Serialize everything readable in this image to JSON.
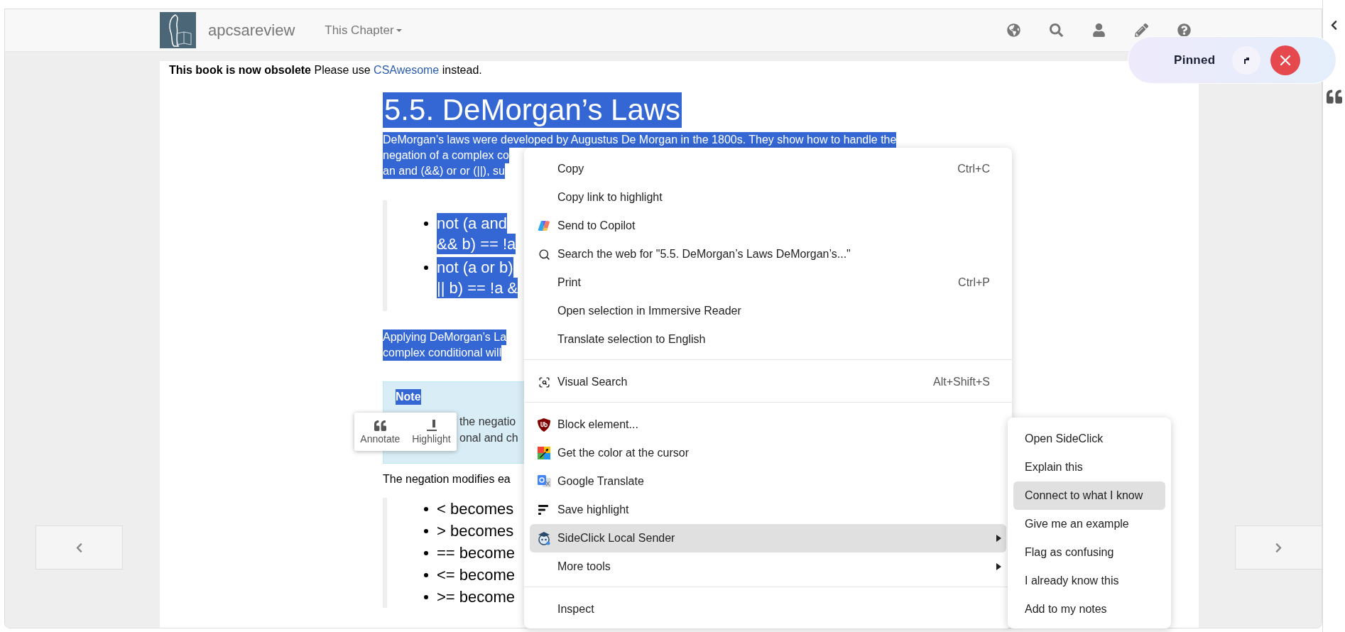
{
  "navbar": {
    "brand": "apcsareview",
    "menu": "This Chapter"
  },
  "notice": {
    "lead": "**This book is now obsolete** Please use",
    "link": "CSAwesome",
    "tail": "instead."
  },
  "article": {
    "heading": {
      "text": "5.5. DeMorgan’s Laws",
      "selected": true
    },
    "intro": {
      "selected": true,
      "lines": [
        "DeMorgan’s laws were developed by Augustus De Morgan in the 1800s. They show how to handle the",
        "negation of a complex co",
        "an and (&&) or or (||), su"
      ]
    },
    "laws": [
      {
        "selected": true,
        "lines": [
          "not (a and",
          "&& b) == !a"
        ]
      },
      {
        "selected": true,
        "lines": [
          "not (a or b)",
          "|| b) == !a &"
        ]
      }
    ],
    "applying": {
      "selected": true,
      "lines": [
        "Applying DeMorgan’s La",
        "complex conditional will"
      ]
    },
    "note": {
      "title": "Note",
      "title_selected": true,
      "lines": [
        "the negatio",
        "onal and ch"
      ]
    },
    "negation": {
      "text": "The negation modifies ea",
      "selected": false
    },
    "rules": [
      "< becomes",
      "> becomes",
      "== become",
      "<= become",
      ">= become"
    ]
  },
  "annotate_popup": {
    "buttons": [
      "Annotate",
      "Highlight"
    ]
  },
  "context_menu": {
    "groups": [
      [
        {
          "label": "Copy",
          "shortcut": "Ctrl+C",
          "submenu": false,
          "highlighted": false
        },
        {
          "label": "Copy link to highlight",
          "submenu": false,
          "highlighted": false
        },
        {
          "label": "Send to Copilot",
          "submenu": false,
          "highlighted": false
        },
        {
          "label": "Search the web for \"5.5. DeMorgan’s Laws DeMorgan’s...\"",
          "submenu": false,
          "highlighted": false
        },
        {
          "label": "Print",
          "shortcut": "Ctrl+P",
          "submenu": false,
          "highlighted": false
        },
        {
          "label": "Open selection in Immersive Reader",
          "submenu": false,
          "highlighted": false
        },
        {
          "label": "Translate selection to English",
          "submenu": false,
          "highlighted": false
        }
      ],
      [
        {
          "label": "Visual Search",
          "shortcut": "Alt+Shift+S",
          "submenu": false,
          "highlighted": false
        }
      ],
      [
        {
          "label": "Block element...",
          "submenu": false,
          "highlighted": false
        },
        {
          "label": "Get the color at the cursor",
          "submenu": false,
          "highlighted": false
        },
        {
          "label": "Google Translate",
          "submenu": false,
          "highlighted": false
        },
        {
          "label": "Save highlight",
          "submenu": false,
          "highlighted": false
        },
        {
          "label": "SideClick Local Sender",
          "submenu": true,
          "highlighted": true
        },
        {
          "label": "More tools",
          "submenu": true,
          "highlighted": false
        }
      ],
      [
        {
          "label": "Inspect",
          "submenu": false,
          "highlighted": false
        }
      ]
    ]
  },
  "submenu": {
    "items": [
      {
        "label": "Open SideClick",
        "highlighted": false
      },
      {
        "label": "Explain this",
        "highlighted": false
      },
      {
        "label": "Connect to what I know",
        "highlighted": true
      },
      {
        "label": "Give me an example",
        "highlighted": false
      },
      {
        "label": "Flag as confusing",
        "highlighted": false
      },
      {
        "label": "I already know this",
        "highlighted": false
      },
      {
        "label": "Add to my notes",
        "highlighted": false
      }
    ]
  },
  "pinned": {
    "label": "Pinned"
  }
}
